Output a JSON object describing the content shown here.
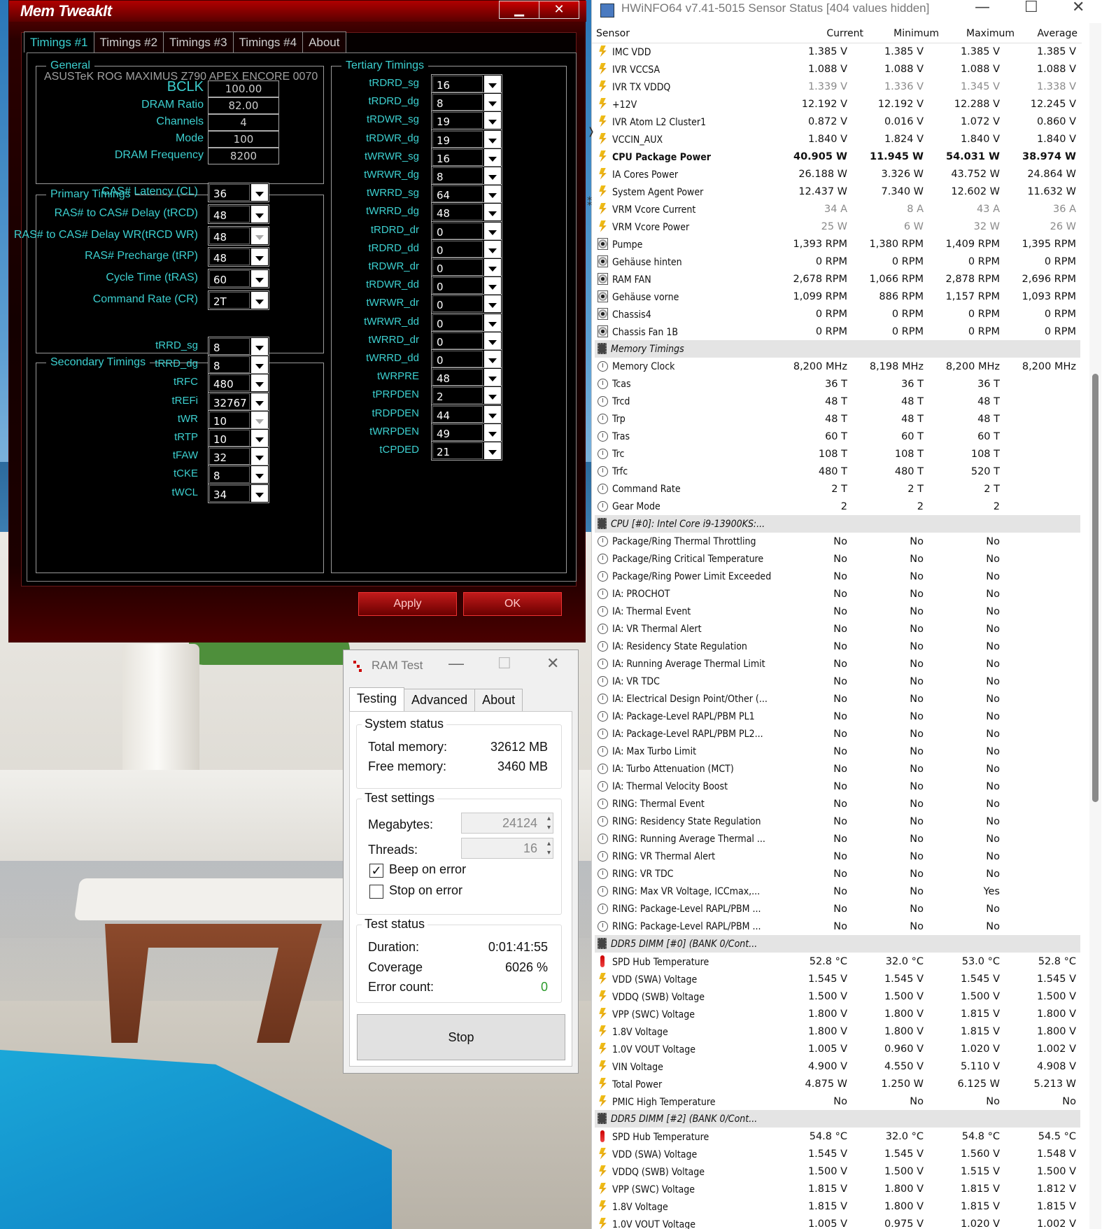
{
  "memtweakit": {
    "title": "Mem TweakIt",
    "minimize": "▁",
    "close": "✕",
    "tabs": [
      "Timings #1",
      "Timings #2",
      "Timings #3",
      "Timings #4",
      "About"
    ],
    "general": {
      "legend": "General",
      "board": "ASUSTeK ROG MAXIMUS Z790 APEX ENCORE 0070",
      "fields": [
        {
          "label": "BCLK",
          "value": "100.00"
        },
        {
          "label": "DRAM Ratio",
          "value": "82.00"
        },
        {
          "label": "Channels",
          "value": "4"
        },
        {
          "label": "Mode",
          "value": "100"
        },
        {
          "label": "DRAM Frequency",
          "value": "8200"
        }
      ]
    },
    "primary": {
      "legend": "Primary Timings",
      "fields": [
        {
          "label": "CAS# Latency (CL)",
          "value": "36"
        },
        {
          "label": "RAS# to CAS# Delay (tRCD)",
          "value": "48"
        },
        {
          "label": "RAS# to CAS# Delay WR(tRCD WR)",
          "value": "48",
          "disabled": true
        },
        {
          "label": "RAS# Precharge (tRP)",
          "value": "48"
        },
        {
          "label": "Cycle Time (tRAS)",
          "value": "60"
        },
        {
          "label": "Command Rate (CR)",
          "value": "2T"
        }
      ]
    },
    "secondary": {
      "legend": "Secondary Timings",
      "fields": [
        {
          "label": "tRRD_sg",
          "value": "8"
        },
        {
          "label": "tRRD_dg",
          "value": "8"
        },
        {
          "label": "tRFC",
          "value": "480"
        },
        {
          "label": "tREFi",
          "value": "32767"
        },
        {
          "label": "tWR",
          "value": "10",
          "disabled": true
        },
        {
          "label": "tRTP",
          "value": "10"
        },
        {
          "label": "tFAW",
          "value": "32"
        },
        {
          "label": "tCKE",
          "value": "8"
        },
        {
          "label": "tWCL",
          "value": "34"
        }
      ]
    },
    "tertiary": {
      "legend": "Tertiary Timings",
      "fields": [
        {
          "label": "tRDRD_sg",
          "value": "16"
        },
        {
          "label": "tRDRD_dg",
          "value": "8"
        },
        {
          "label": "tRDWR_sg",
          "value": "19"
        },
        {
          "label": "tRDWR_dg",
          "value": "19"
        },
        {
          "label": "tWRWR_sg",
          "value": "16"
        },
        {
          "label": "tWRWR_dg",
          "value": "8"
        },
        {
          "label": "tWRRD_sg",
          "value": "64"
        },
        {
          "label": "tWRRD_dg",
          "value": "48"
        },
        {
          "label": "tRDRD_dr",
          "value": "0"
        },
        {
          "label": "tRDRD_dd",
          "value": "0"
        },
        {
          "label": "tRDWR_dr",
          "value": "0"
        },
        {
          "label": "tRDWR_dd",
          "value": "0"
        },
        {
          "label": "tWRWR_dr",
          "value": "0"
        },
        {
          "label": "tWRWR_dd",
          "value": "0"
        },
        {
          "label": "tWRRD_dr",
          "value": "0"
        },
        {
          "label": "tWRRD_dd",
          "value": "0"
        },
        {
          "label": "tWRPRE",
          "value": "48"
        },
        {
          "label": "tPRPDEN",
          "value": "2"
        },
        {
          "label": "tRDPDEN",
          "value": "44"
        },
        {
          "label": "tWRPDEN",
          "value": "49"
        },
        {
          "label": "tCPDED",
          "value": "21"
        }
      ]
    },
    "apply": "Apply",
    "ok": "OK"
  },
  "ramtest": {
    "title": "RAM Test",
    "minimize": "—",
    "maximize": "☐",
    "close": "✕",
    "tabs": [
      "Testing",
      "Advanced",
      "About"
    ],
    "system_status": {
      "legend": "System status",
      "total_label": "Total memory:",
      "total_value": "32612 MB",
      "free_label": "Free memory:",
      "free_value": "3460 MB"
    },
    "test_settings": {
      "legend": "Test settings",
      "mb_label": "Megabytes:",
      "mb_value": "24124",
      "threads_label": "Threads:",
      "threads_value": "16",
      "beep_label": "Beep on error",
      "beep_checked": true,
      "stop_label": "Stop on error",
      "stop_checked": false
    },
    "test_status": {
      "legend": "Test status",
      "duration_label": "Duration:",
      "duration_value": "0:01:41:55",
      "coverage_label": "Coverage",
      "coverage_value": "6026 %",
      "errors_label": "Error count:",
      "errors_value": "0"
    },
    "stop_button": "Stop"
  },
  "hwinfo": {
    "title": "HWiNFO64 v7.41-5015 Sensor Status [404 values hidden]",
    "minimize": "—",
    "maximize": "☐",
    "close": "✕",
    "columns": [
      "Sensor",
      "Current",
      "Minimum",
      "Maximum",
      "Average"
    ],
    "edge_glyphs": [
      "❭",
      "⁑"
    ],
    "rows": [
      {
        "icon": "volt",
        "name": "IMC VDD",
        "cur": "1.385 V",
        "min": "1.385 V",
        "max": "1.385 V",
        "avg": "1.385 V"
      },
      {
        "icon": "volt",
        "name": "IVR VCCSA",
        "cur": "1.088 V",
        "min": "1.088 V",
        "max": "1.088 V",
        "avg": "1.088 V"
      },
      {
        "icon": "volt",
        "name": "IVR TX VDDQ",
        "cur": "1.339 V",
        "min": "1.336 V",
        "max": "1.345 V",
        "avg": "1.338 V",
        "gray": true
      },
      {
        "icon": "volt",
        "name": "+12V",
        "cur": "12.192 V",
        "min": "12.192 V",
        "max": "12.288 V",
        "avg": "12.245 V"
      },
      {
        "icon": "volt",
        "name": "IVR Atom L2 Cluster1",
        "cur": "0.872 V",
        "min": "0.016 V",
        "max": "1.072 V",
        "avg": "0.860 V"
      },
      {
        "icon": "volt",
        "name": "VCCIN_AUX",
        "cur": "1.840 V",
        "min": "1.824 V",
        "max": "1.840 V",
        "avg": "1.840 V"
      },
      {
        "icon": "volt",
        "name": "CPU Package Power",
        "cur": "40.905 W",
        "min": "11.945 W",
        "max": "54.031 W",
        "avg": "38.974 W",
        "bold": true
      },
      {
        "icon": "volt",
        "name": "IA Cores Power",
        "cur": "26.188 W",
        "min": "3.326 W",
        "max": "43.752 W",
        "avg": "24.864 W"
      },
      {
        "icon": "volt",
        "name": "System Agent Power",
        "cur": "12.437 W",
        "min": "7.340 W",
        "max": "12.602 W",
        "avg": "11.632 W"
      },
      {
        "icon": "volt",
        "name": "VRM Vcore Current",
        "cur": "34 A",
        "min": "8 A",
        "max": "43 A",
        "avg": "36 A",
        "gray": true
      },
      {
        "icon": "volt",
        "name": "VRM Vcore Power",
        "cur": "25 W",
        "min": "6 W",
        "max": "32 W",
        "avg": "26 W",
        "gray": true
      },
      {
        "icon": "fan",
        "name": "Pumpe",
        "cur": "1,393 RPM",
        "min": "1,380 RPM",
        "max": "1,409 RPM",
        "avg": "1,395 RPM"
      },
      {
        "icon": "fan",
        "name": "Gehäuse hinten",
        "cur": "0 RPM",
        "min": "0 RPM",
        "max": "0 RPM",
        "avg": "0 RPM"
      },
      {
        "icon": "fan",
        "name": "RAM FAN",
        "cur": "2,678 RPM",
        "min": "1,066 RPM",
        "max": "2,878 RPM",
        "avg": "2,696 RPM"
      },
      {
        "icon": "fan",
        "name": "Gehäuse vorne",
        "cur": "1,099 RPM",
        "min": "886 RPM",
        "max": "1,157 RPM",
        "avg": "1,093 RPM"
      },
      {
        "icon": "fan",
        "name": "Chassis4",
        "cur": "0 RPM",
        "min": "0 RPM",
        "max": "0 RPM",
        "avg": "0 RPM"
      },
      {
        "icon": "fan",
        "name": "Chassis Fan 1B",
        "cur": "0 RPM",
        "min": "0 RPM",
        "max": "0 RPM",
        "avg": "0 RPM"
      },
      {
        "icon": "chip",
        "name": "Memory Timings",
        "section": true
      },
      {
        "icon": "clk",
        "name": "Memory Clock",
        "cur": "8,200 MHz",
        "min": "8,198 MHz",
        "max": "8,200 MHz",
        "avg": "8,200 MHz"
      },
      {
        "icon": "clk",
        "name": "Tcas",
        "cur": "36 T",
        "min": "36 T",
        "max": "36 T",
        "avg": ""
      },
      {
        "icon": "clk",
        "name": "Trcd",
        "cur": "48 T",
        "min": "48 T",
        "max": "48 T",
        "avg": ""
      },
      {
        "icon": "clk",
        "name": "Trp",
        "cur": "48 T",
        "min": "48 T",
        "max": "48 T",
        "avg": ""
      },
      {
        "icon": "clk",
        "name": "Tras",
        "cur": "60 T",
        "min": "60 T",
        "max": "60 T",
        "avg": ""
      },
      {
        "icon": "clk",
        "name": "Trc",
        "cur": "108 T",
        "min": "108 T",
        "max": "108 T",
        "avg": ""
      },
      {
        "icon": "clk",
        "name": "Trfc",
        "cur": "480 T",
        "min": "480 T",
        "max": "520 T",
        "avg": ""
      },
      {
        "icon": "clk",
        "name": "Command Rate",
        "cur": "2 T",
        "min": "2 T",
        "max": "2 T",
        "avg": ""
      },
      {
        "icon": "clk",
        "name": "Gear Mode",
        "cur": "2",
        "min": "2",
        "max": "2",
        "avg": ""
      },
      {
        "icon": "chip",
        "name": "CPU [#0]: Intel Core i9-13900KS:...",
        "section": true
      },
      {
        "icon": "clk",
        "name": "Package/Ring Thermal Throttling",
        "cur": "No",
        "min": "No",
        "max": "No",
        "avg": ""
      },
      {
        "icon": "clk",
        "name": "Package/Ring Critical Temperature",
        "cur": "No",
        "min": "No",
        "max": "No",
        "avg": ""
      },
      {
        "icon": "clk",
        "name": "Package/Ring Power Limit Exceeded",
        "cur": "No",
        "min": "No",
        "max": "No",
        "avg": ""
      },
      {
        "icon": "clk",
        "name": "IA: PROCHOT",
        "cur": "No",
        "min": "No",
        "max": "No",
        "avg": ""
      },
      {
        "icon": "clk",
        "name": "IA: Thermal Event",
        "cur": "No",
        "min": "No",
        "max": "No",
        "avg": ""
      },
      {
        "icon": "clk",
        "name": "IA: VR Thermal Alert",
        "cur": "No",
        "min": "No",
        "max": "No",
        "avg": ""
      },
      {
        "icon": "clk",
        "name": "IA: Residency State Regulation",
        "cur": "No",
        "min": "No",
        "max": "No",
        "avg": ""
      },
      {
        "icon": "clk",
        "name": "IA: Running Average Thermal Limit",
        "cur": "No",
        "min": "No",
        "max": "No",
        "avg": ""
      },
      {
        "icon": "clk",
        "name": "IA: VR TDC",
        "cur": "No",
        "min": "No",
        "max": "No",
        "avg": ""
      },
      {
        "icon": "clk",
        "name": "IA: Electrical Design Point/Other (...",
        "cur": "No",
        "min": "No",
        "max": "No",
        "avg": ""
      },
      {
        "icon": "clk",
        "name": "IA: Package-Level RAPL/PBM PL1",
        "cur": "No",
        "min": "No",
        "max": "No",
        "avg": ""
      },
      {
        "icon": "clk",
        "name": "IA: Package-Level RAPL/PBM PL2...",
        "cur": "No",
        "min": "No",
        "max": "No",
        "avg": ""
      },
      {
        "icon": "clk",
        "name": "IA: Max Turbo Limit",
        "cur": "No",
        "min": "No",
        "max": "No",
        "avg": ""
      },
      {
        "icon": "clk",
        "name": "IA: Turbo Attenuation (MCT)",
        "cur": "No",
        "min": "No",
        "max": "No",
        "avg": ""
      },
      {
        "icon": "clk",
        "name": "IA: Thermal Velocity Boost",
        "cur": "No",
        "min": "No",
        "max": "No",
        "avg": ""
      },
      {
        "icon": "clk",
        "name": "RING: Thermal Event",
        "cur": "No",
        "min": "No",
        "max": "No",
        "avg": ""
      },
      {
        "icon": "clk",
        "name": "RING: Residency State Regulation",
        "cur": "No",
        "min": "No",
        "max": "No",
        "avg": ""
      },
      {
        "icon": "clk",
        "name": "RING: Running Average Thermal ...",
        "cur": "No",
        "min": "No",
        "max": "No",
        "avg": ""
      },
      {
        "icon": "clk",
        "name": "RING: VR Thermal Alert",
        "cur": "No",
        "min": "No",
        "max": "No",
        "avg": ""
      },
      {
        "icon": "clk",
        "name": "RING: VR TDC",
        "cur": "No",
        "min": "No",
        "max": "No",
        "avg": ""
      },
      {
        "icon": "clk",
        "name": "RING: Max VR Voltage, ICCmax,...",
        "cur": "No",
        "min": "No",
        "max": "Yes",
        "avg": ""
      },
      {
        "icon": "clk",
        "name": "RING: Package-Level RAPL/PBM ...",
        "cur": "No",
        "min": "No",
        "max": "No",
        "avg": ""
      },
      {
        "icon": "clk",
        "name": "RING: Package-Level RAPL/PBM ...",
        "cur": "No",
        "min": "No",
        "max": "No",
        "avg": ""
      },
      {
        "icon": "chip",
        "name": "DDR5 DIMM [#0] (BANK 0/Cont...",
        "section": true
      },
      {
        "icon": "temp",
        "name": "SPD Hub Temperature",
        "cur": "52.8 °C",
        "min": "32.0 °C",
        "max": "53.0 °C",
        "avg": "52.8 °C"
      },
      {
        "icon": "volt",
        "name": "VDD (SWA) Voltage",
        "cur": "1.545 V",
        "min": "1.545 V",
        "max": "1.545 V",
        "avg": "1.545 V"
      },
      {
        "icon": "volt",
        "name": "VDDQ (SWB) Voltage",
        "cur": "1.500 V",
        "min": "1.500 V",
        "max": "1.500 V",
        "avg": "1.500 V"
      },
      {
        "icon": "volt",
        "name": "VPP (SWC) Voltage",
        "cur": "1.800 V",
        "min": "1.800 V",
        "max": "1.815 V",
        "avg": "1.800 V"
      },
      {
        "icon": "volt",
        "name": "1.8V Voltage",
        "cur": "1.800 V",
        "min": "1.800 V",
        "max": "1.815 V",
        "avg": "1.800 V"
      },
      {
        "icon": "volt",
        "name": "1.0V VOUT Voltage",
        "cur": "1.005 V",
        "min": "0.960 V",
        "max": "1.020 V",
        "avg": "1.002 V"
      },
      {
        "icon": "volt",
        "name": "VIN Voltage",
        "cur": "4.900 V",
        "min": "4.550 V",
        "max": "5.110 V",
        "avg": "4.908 V"
      },
      {
        "icon": "volt",
        "name": "Total Power",
        "cur": "4.875 W",
        "min": "1.250 W",
        "max": "6.125 W",
        "avg": "5.213 W"
      },
      {
        "icon": "volt",
        "name": "PMIC High Temperature",
        "cur": "No",
        "min": "No",
        "max": "No",
        "avg": "No"
      },
      {
        "icon": "chip",
        "name": "DDR5 DIMM [#2] (BANK 0/Cont...",
        "section": true
      },
      {
        "icon": "temp",
        "name": "SPD Hub Temperature",
        "cur": "54.8 °C",
        "min": "32.0 °C",
        "max": "54.8 °C",
        "avg": "54.5 °C"
      },
      {
        "icon": "volt",
        "name": "VDD (SWA) Voltage",
        "cur": "1.545 V",
        "min": "1.545 V",
        "max": "1.560 V",
        "avg": "1.548 V"
      },
      {
        "icon": "volt",
        "name": "VDDQ (SWB) Voltage",
        "cur": "1.500 V",
        "min": "1.500 V",
        "max": "1.515 V",
        "avg": "1.500 V"
      },
      {
        "icon": "volt",
        "name": "VPP (SWC) Voltage",
        "cur": "1.815 V",
        "min": "1.800 V",
        "max": "1.815 V",
        "avg": "1.812 V"
      },
      {
        "icon": "volt",
        "name": "1.8V Voltage",
        "cur": "1.815 V",
        "min": "1.800 V",
        "max": "1.815 V",
        "avg": "1.815 V"
      },
      {
        "icon": "volt",
        "name": "1.0V VOUT Voltage",
        "cur": "1.005 V",
        "min": "0.975 V",
        "max": "1.020 V",
        "avg": "1.002 V"
      }
    ]
  }
}
